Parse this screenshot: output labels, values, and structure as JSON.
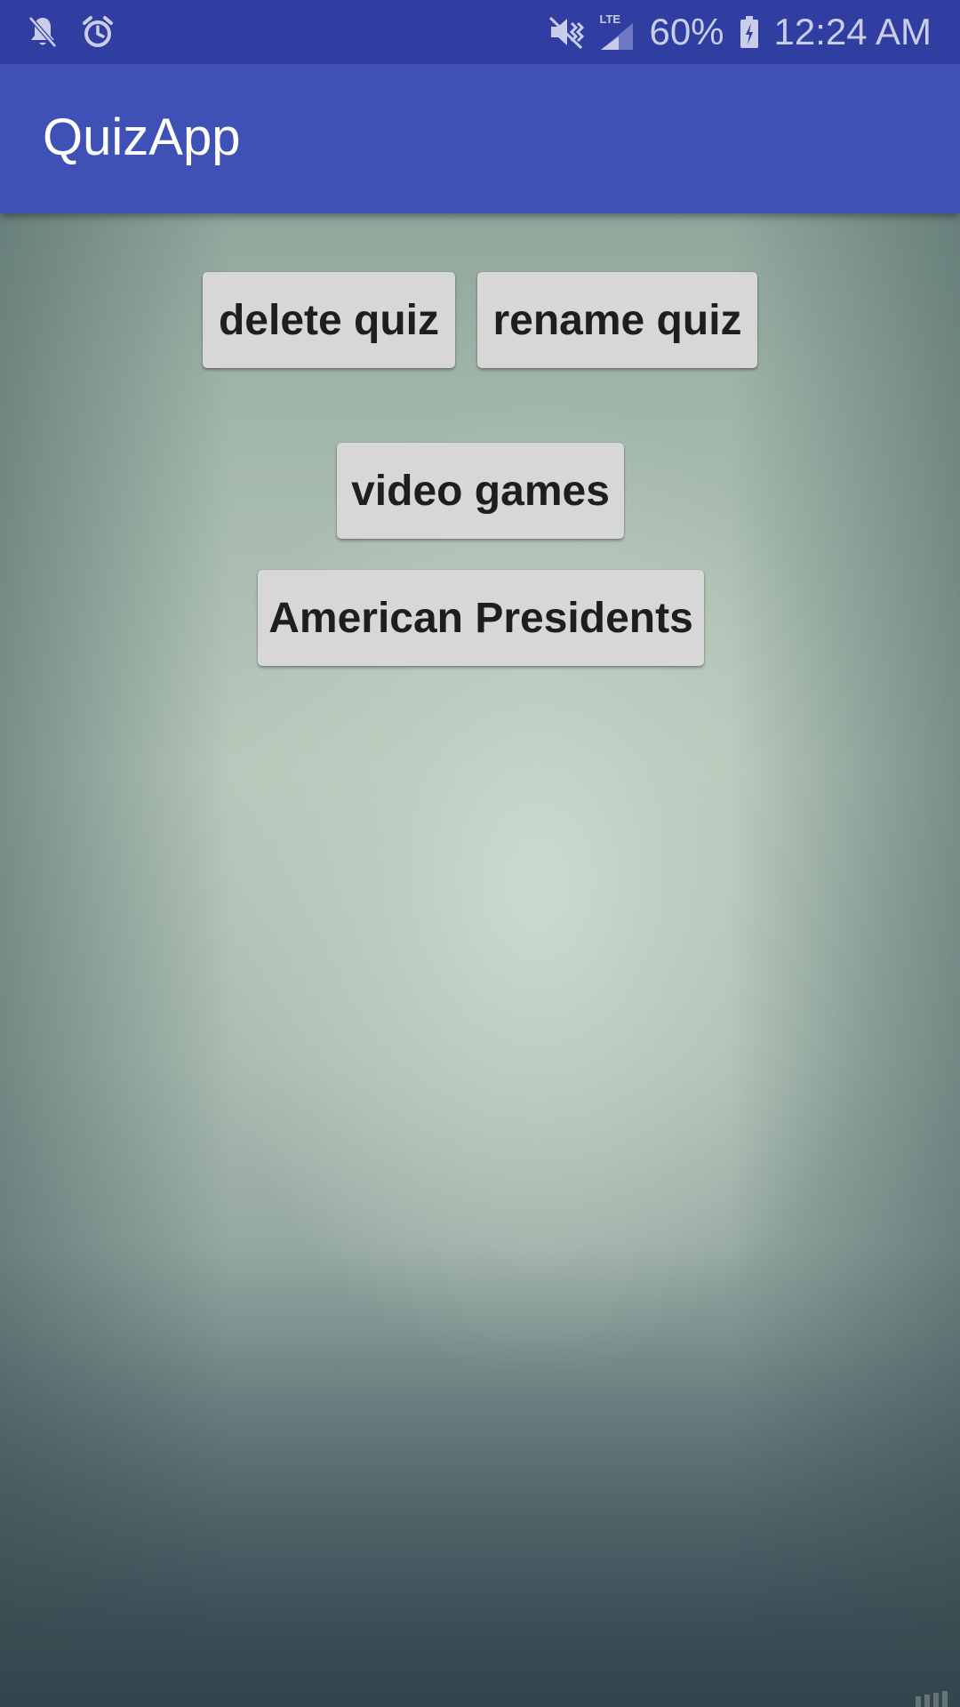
{
  "status_bar": {
    "battery": "60%",
    "time": "12:24 AM",
    "network_label": "LTE",
    "icons": {
      "notifications_muted": "bell-off-icon",
      "alarm": "alarm-clock-icon",
      "sound_muted": "vibrate-muted-icon",
      "signal": "signal-strength-icon",
      "battery": "battery-charging-icon"
    },
    "colors": {
      "background": "#2f3ea0",
      "foreground": "#c9cdea"
    }
  },
  "app_bar": {
    "title": "QuizApp",
    "color": "#3f51b5"
  },
  "actions": {
    "delete_label": "delete quiz",
    "rename_label": "rename quiz"
  },
  "quizzes": [
    {
      "label": "video games"
    },
    {
      "label": "American Presidents"
    }
  ],
  "theme": {
    "button_background": "#d6d7d6",
    "button_text": "#1e1e1e"
  }
}
